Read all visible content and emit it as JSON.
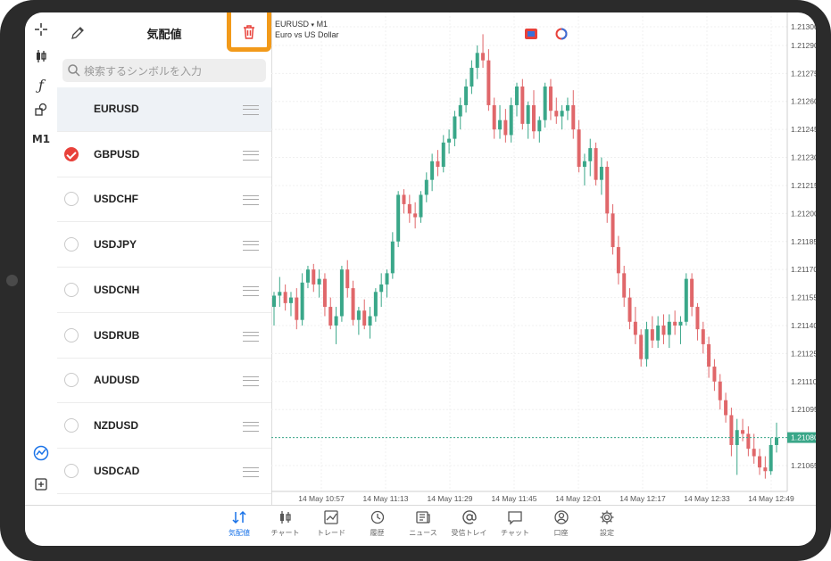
{
  "watchlist": {
    "title": "気配値",
    "search_placeholder": "検索するシンボルを入力",
    "symbols": [
      {
        "name": "EURUSD",
        "state": "selected"
      },
      {
        "name": "GBPUSD",
        "state": "checked"
      },
      {
        "name": "USDCHF",
        "state": "unchecked"
      },
      {
        "name": "USDJPY",
        "state": "unchecked"
      },
      {
        "name": "USDCNH",
        "state": "unchecked"
      },
      {
        "name": "USDRUB",
        "state": "unchecked"
      },
      {
        "name": "AUDUSD",
        "state": "unchecked"
      },
      {
        "name": "NZDUSD",
        "state": "unchecked"
      },
      {
        "name": "USDCAD",
        "state": "unchecked"
      }
    ]
  },
  "toolbar": {
    "icons": [
      "crosshair-icon",
      "candlestick-icon",
      "indicator-icon",
      "objects-icon"
    ],
    "timeframe": "M1",
    "bottom_icons": [
      "chart-logo-icon",
      "add-window-icon"
    ]
  },
  "chart": {
    "symbol": "EURUSD",
    "timeframe": "M1",
    "description": "Euro vs US Dollar",
    "current_price": "1.21080"
  },
  "chart_data": {
    "type": "candlestick",
    "symbol": "EURUSD",
    "timeframe": "M1",
    "y_ticks": [
      "1.21300",
      "1.21290",
      "1.21275",
      "1.21260",
      "1.21245",
      "1.21230",
      "1.21215",
      "1.21200",
      "1.21185",
      "1.21170",
      "1.21155",
      "1.21140",
      "1.21125",
      "1.21110",
      "1.21095",
      "1.21080",
      "1.21065"
    ],
    "x_ticks": [
      "14 May 10:57",
      "14 May 11:13",
      "14 May 11:29",
      "14 May 11:45",
      "14 May 12:01",
      "14 May 12:17",
      "14 May 12:33",
      "14 May 12:49"
    ],
    "ylim": [
      1.2106,
      1.213
    ],
    "bull_color": "#3aa789",
    "bear_color": "#e0676a",
    "candles": [
      {
        "o": 1.2115,
        "h": 1.21158,
        "l": 1.2114,
        "c": 1.21156
      },
      {
        "o": 1.21156,
        "h": 1.21166,
        "l": 1.2115,
        "c": 1.21158
      },
      {
        "o": 1.21158,
        "h": 1.21162,
        "l": 1.21148,
        "c": 1.21152
      },
      {
        "o": 1.21152,
        "h": 1.21158,
        "l": 1.21145,
        "c": 1.21155
      },
      {
        "o": 1.21155,
        "h": 1.2116,
        "l": 1.21138,
        "c": 1.21143
      },
      {
        "o": 1.21143,
        "h": 1.21168,
        "l": 1.2114,
        "c": 1.21163
      },
      {
        "o": 1.21163,
        "h": 1.21172,
        "l": 1.2116,
        "c": 1.2117
      },
      {
        "o": 1.2117,
        "h": 1.21173,
        "l": 1.21158,
        "c": 1.21162
      },
      {
        "o": 1.21162,
        "h": 1.2117,
        "l": 1.21155,
        "c": 1.21165
      },
      {
        "o": 1.21165,
        "h": 1.21168,
        "l": 1.21145,
        "c": 1.2115
      },
      {
        "o": 1.2115,
        "h": 1.21155,
        "l": 1.21138,
        "c": 1.2114
      },
      {
        "o": 1.2114,
        "h": 1.2115,
        "l": 1.2113,
        "c": 1.21145
      },
      {
        "o": 1.21145,
        "h": 1.21172,
        "l": 1.21142,
        "c": 1.2117
      },
      {
        "o": 1.2117,
        "h": 1.21175,
        "l": 1.21155,
        "c": 1.2116
      },
      {
        "o": 1.2116,
        "h": 1.21164,
        "l": 1.2114,
        "c": 1.21143
      },
      {
        "o": 1.21143,
        "h": 1.2115,
        "l": 1.21135,
        "c": 1.21148
      },
      {
        "o": 1.21148,
        "h": 1.21154,
        "l": 1.21138,
        "c": 1.2114
      },
      {
        "o": 1.2114,
        "h": 1.2115,
        "l": 1.21133,
        "c": 1.21145
      },
      {
        "o": 1.21145,
        "h": 1.2116,
        "l": 1.21142,
        "c": 1.21158
      },
      {
        "o": 1.21158,
        "h": 1.21168,
        "l": 1.2115,
        "c": 1.21162
      },
      {
        "o": 1.21162,
        "h": 1.2117,
        "l": 1.21155,
        "c": 1.21168
      },
      {
        "o": 1.21168,
        "h": 1.2119,
        "l": 1.21165,
        "c": 1.21185
      },
      {
        "o": 1.21185,
        "h": 1.21212,
        "l": 1.21182,
        "c": 1.2121
      },
      {
        "o": 1.2121,
        "h": 1.21213,
        "l": 1.212,
        "c": 1.21205
      },
      {
        "o": 1.21205,
        "h": 1.2121,
        "l": 1.21195,
        "c": 1.212
      },
      {
        "o": 1.212,
        "h": 1.21206,
        "l": 1.21192,
        "c": 1.21198
      },
      {
        "o": 1.21198,
        "h": 1.21212,
        "l": 1.21195,
        "c": 1.2121
      },
      {
        "o": 1.2121,
        "h": 1.21222,
        "l": 1.21206,
        "c": 1.21218
      },
      {
        "o": 1.21218,
        "h": 1.21232,
        "l": 1.21212,
        "c": 1.21228
      },
      {
        "o": 1.21228,
        "h": 1.21234,
        "l": 1.2122,
        "c": 1.21225
      },
      {
        "o": 1.21225,
        "h": 1.21242,
        "l": 1.21222,
        "c": 1.21238
      },
      {
        "o": 1.21238,
        "h": 1.21245,
        "l": 1.21232,
        "c": 1.2124
      },
      {
        "o": 1.2124,
        "h": 1.21255,
        "l": 1.21236,
        "c": 1.21252
      },
      {
        "o": 1.21252,
        "h": 1.21262,
        "l": 1.21245,
        "c": 1.21258
      },
      {
        "o": 1.21258,
        "h": 1.21272,
        "l": 1.21254,
        "c": 1.21268
      },
      {
        "o": 1.21268,
        "h": 1.21282,
        "l": 1.21264,
        "c": 1.21278
      },
      {
        "o": 1.21278,
        "h": 1.2129,
        "l": 1.21272,
        "c": 1.21286
      },
      {
        "o": 1.21286,
        "h": 1.21296,
        "l": 1.21278,
        "c": 1.21282
      },
      {
        "o": 1.21282,
        "h": 1.21288,
        "l": 1.21255,
        "c": 1.21258
      },
      {
        "o": 1.21258,
        "h": 1.21262,
        "l": 1.2124,
        "c": 1.21245
      },
      {
        "o": 1.21245,
        "h": 1.21258,
        "l": 1.2124,
        "c": 1.2125
      },
      {
        "o": 1.2125,
        "h": 1.21256,
        "l": 1.21238,
        "c": 1.21242
      },
      {
        "o": 1.21242,
        "h": 1.21262,
        "l": 1.21238,
        "c": 1.21258
      },
      {
        "o": 1.21258,
        "h": 1.2127,
        "l": 1.21252,
        "c": 1.21268
      },
      {
        "o": 1.21268,
        "h": 1.21272,
        "l": 1.21245,
        "c": 1.21248
      },
      {
        "o": 1.21248,
        "h": 1.2126,
        "l": 1.2124,
        "c": 1.21258
      },
      {
        "o": 1.21258,
        "h": 1.21266,
        "l": 1.2124,
        "c": 1.21244
      },
      {
        "o": 1.21244,
        "h": 1.21252,
        "l": 1.21238,
        "c": 1.2125
      },
      {
        "o": 1.2125,
        "h": 1.2127,
        "l": 1.21246,
        "c": 1.21268
      },
      {
        "o": 1.21268,
        "h": 1.21272,
        "l": 1.2125,
        "c": 1.21255
      },
      {
        "o": 1.21255,
        "h": 1.21262,
        "l": 1.21248,
        "c": 1.21252
      },
      {
        "o": 1.21252,
        "h": 1.21258,
        "l": 1.21245,
        "c": 1.21255
      },
      {
        "o": 1.21255,
        "h": 1.21262,
        "l": 1.2125,
        "c": 1.21258
      },
      {
        "o": 1.21258,
        "h": 1.21266,
        "l": 1.2124,
        "c": 1.21245
      },
      {
        "o": 1.21245,
        "h": 1.2125,
        "l": 1.21222,
        "c": 1.21225
      },
      {
        "o": 1.21225,
        "h": 1.21232,
        "l": 1.21215,
        "c": 1.21228
      },
      {
        "o": 1.21228,
        "h": 1.2124,
        "l": 1.2122,
        "c": 1.21235
      },
      {
        "o": 1.21235,
        "h": 1.21238,
        "l": 1.21215,
        "c": 1.21218
      },
      {
        "o": 1.21218,
        "h": 1.2123,
        "l": 1.2121,
        "c": 1.21225
      },
      {
        "o": 1.21225,
        "h": 1.21228,
        "l": 1.21195,
        "c": 1.212
      },
      {
        "o": 1.212,
        "h": 1.21205,
        "l": 1.21178,
        "c": 1.21182
      },
      {
        "o": 1.21182,
        "h": 1.21188,
        "l": 1.21162,
        "c": 1.21168
      },
      {
        "o": 1.21168,
        "h": 1.21172,
        "l": 1.2115,
        "c": 1.21155
      },
      {
        "o": 1.21155,
        "h": 1.2116,
        "l": 1.21138,
        "c": 1.21142
      },
      {
        "o": 1.21142,
        "h": 1.2115,
        "l": 1.2113,
        "c": 1.21135
      },
      {
        "o": 1.21135,
        "h": 1.21138,
        "l": 1.21118,
        "c": 1.21122
      },
      {
        "o": 1.21122,
        "h": 1.21142,
        "l": 1.21118,
        "c": 1.21138
      },
      {
        "o": 1.21138,
        "h": 1.21145,
        "l": 1.21128,
        "c": 1.21132
      },
      {
        "o": 1.21132,
        "h": 1.21145,
        "l": 1.21128,
        "c": 1.2114
      },
      {
        "o": 1.2114,
        "h": 1.21146,
        "l": 1.2113,
        "c": 1.21135
      },
      {
        "o": 1.21135,
        "h": 1.21146,
        "l": 1.21128,
        "c": 1.21142
      },
      {
        "o": 1.21142,
        "h": 1.21148,
        "l": 1.21135,
        "c": 1.2114
      },
      {
        "o": 1.2114,
        "h": 1.21145,
        "l": 1.2113,
        "c": 1.21142
      },
      {
        "o": 1.21142,
        "h": 1.21168,
        "l": 1.2114,
        "c": 1.21165
      },
      {
        "o": 1.21165,
        "h": 1.21168,
        "l": 1.21145,
        "c": 1.2115
      },
      {
        "o": 1.2115,
        "h": 1.21152,
        "l": 1.21132,
        "c": 1.21138
      },
      {
        "o": 1.21138,
        "h": 1.21142,
        "l": 1.21125,
        "c": 1.2113
      },
      {
        "o": 1.2113,
        "h": 1.21134,
        "l": 1.21112,
        "c": 1.21118
      },
      {
        "o": 1.21118,
        "h": 1.21122,
        "l": 1.21105,
        "c": 1.2111
      },
      {
        "o": 1.2111,
        "h": 1.21114,
        "l": 1.21095,
        "c": 1.211
      },
      {
        "o": 1.211,
        "h": 1.21104,
        "l": 1.21088,
        "c": 1.21092
      },
      {
        "o": 1.21092,
        "h": 1.21096,
        "l": 1.2107,
        "c": 1.21076
      },
      {
        "o": 1.21076,
        "h": 1.2109,
        "l": 1.2106,
        "c": 1.21084
      },
      {
        "o": 1.21084,
        "h": 1.2109,
        "l": 1.21078,
        "c": 1.21082
      },
      {
        "o": 1.21082,
        "h": 1.21086,
        "l": 1.2107,
        "c": 1.21074
      },
      {
        "o": 1.21074,
        "h": 1.21082,
        "l": 1.21066,
        "c": 1.2107
      },
      {
        "o": 1.2107,
        "h": 1.21074,
        "l": 1.2106,
        "c": 1.21064
      },
      {
        "o": 1.21064,
        "h": 1.2107,
        "l": 1.21058,
        "c": 1.21062
      },
      {
        "o": 1.21062,
        "h": 1.2108,
        "l": 1.2106,
        "c": 1.21076
      },
      {
        "o": 1.21076,
        "h": 1.21088,
        "l": 1.21072,
        "c": 1.2108
      }
    ]
  },
  "bottom_nav": [
    {
      "label": "気配値",
      "icon": "quotes-icon",
      "active": true
    },
    {
      "label": "チャート",
      "icon": "chart-icon",
      "active": false
    },
    {
      "label": "トレード",
      "icon": "trade-icon",
      "active": false
    },
    {
      "label": "履歴",
      "icon": "history-icon",
      "active": false
    },
    {
      "label": "ニュース",
      "icon": "news-icon",
      "active": false
    },
    {
      "label": "受信トレイ",
      "icon": "mail-icon",
      "active": false
    },
    {
      "label": "チャット",
      "icon": "chat-icon",
      "active": false
    },
    {
      "label": "口座",
      "icon": "account-icon",
      "active": false
    },
    {
      "label": "設定",
      "icon": "settings-icon",
      "active": false
    }
  ]
}
